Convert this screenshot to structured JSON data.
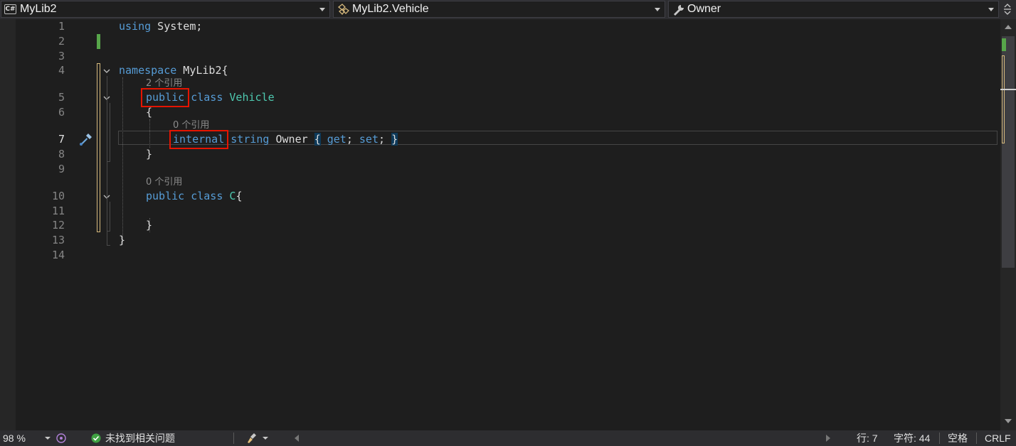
{
  "navbar": {
    "project_badge": "C#",
    "project": "MyLib2",
    "type": "MyLib2.Vehicle",
    "member": "Owner"
  },
  "editor": {
    "line_numbers": [
      "1",
      "2",
      "3",
      "4",
      "5",
      "6",
      "7",
      "8",
      "9",
      "10",
      "11",
      "12",
      "13",
      "14"
    ],
    "current_line": "7",
    "code": {
      "l1_kw": "using",
      "l1_rest": " System;",
      "l4_kw": "namespace",
      "l4_rest": " MyLib2{",
      "l5_kw1": "public",
      "l5_kw2": "class",
      "l5_type": "Vehicle",
      "l6": "{",
      "l7_kw1": "internal",
      "l7_kw2": "string",
      "l7_name": "Owner",
      "l7_ob": "{",
      "l7_get": "get",
      "l7_semi1": ";",
      "l7_set": "set",
      "l7_semi2": ";",
      "l7_cb": "}",
      "l8": "}",
      "l10_kw1": "public",
      "l10_kw2": "class",
      "l10_type": "C",
      "l10_brace": "{",
      "l12": "}",
      "l13": "}"
    },
    "codelens": {
      "vehicle_refs": "2 个引用",
      "owner_refs": "0 个引用",
      "c_refs": "0 个引用"
    }
  },
  "status": {
    "zoom": "98 %",
    "issues": "未找到相关问题",
    "line": "行: 7",
    "char": "字符: 44",
    "indent": "空格",
    "eol": "CRLF"
  },
  "colors": {
    "keyword": "#569cd6",
    "type": "#4ec9b0",
    "highlight_box": "#e51400",
    "change_saved": "#57a64a",
    "change_unsaved": "#d7ba7d"
  }
}
